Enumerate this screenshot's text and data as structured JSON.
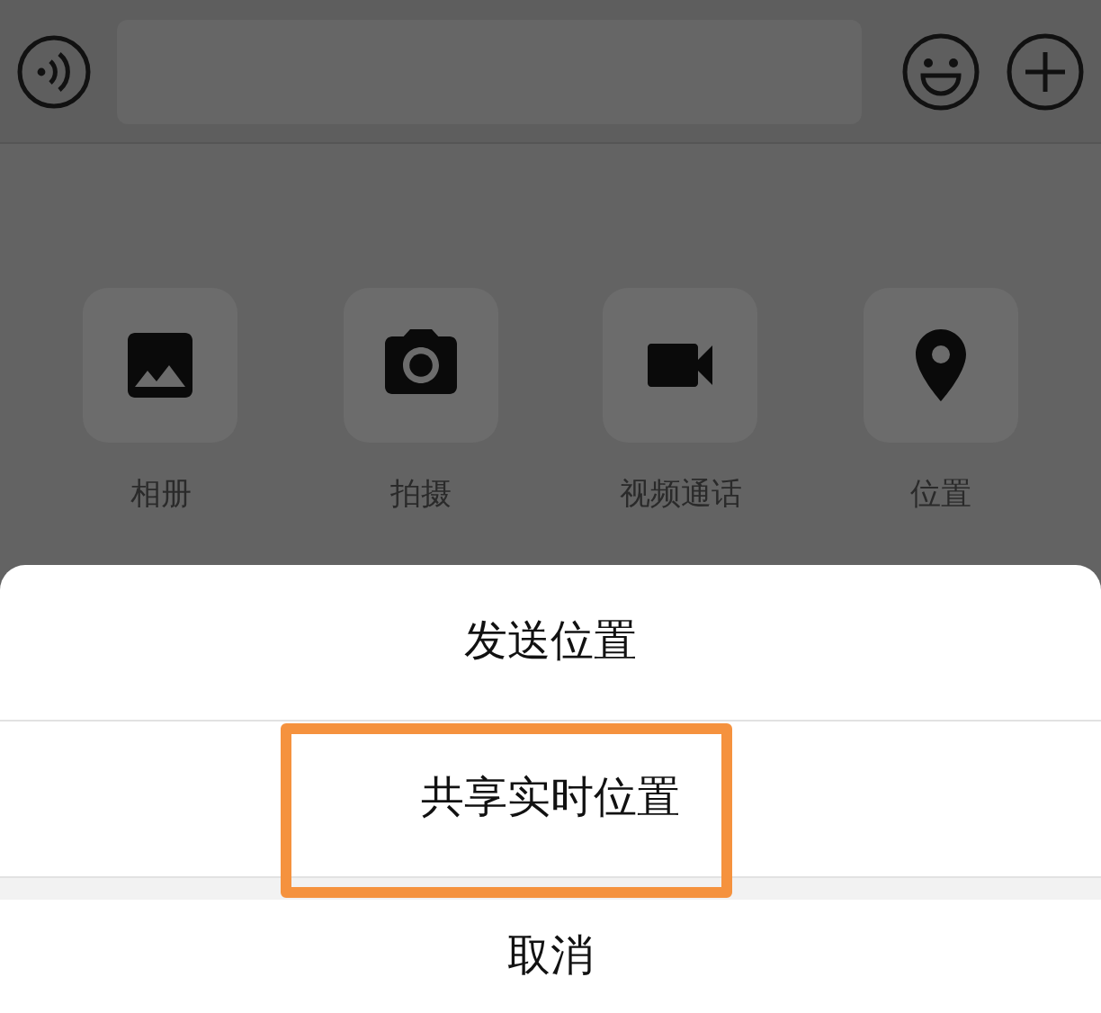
{
  "attachments": [
    {
      "kind": "photo",
      "label": "相册"
    },
    {
      "kind": "camera",
      "label": "拍摄"
    },
    {
      "kind": "video",
      "label": "视频通话"
    },
    {
      "kind": "location",
      "label": "位置"
    }
  ],
  "action_sheet": {
    "options": [
      {
        "label": "发送位置",
        "highlighted": false
      },
      {
        "label": "共享实时位置",
        "highlighted": true
      }
    ],
    "cancel": "取消"
  }
}
